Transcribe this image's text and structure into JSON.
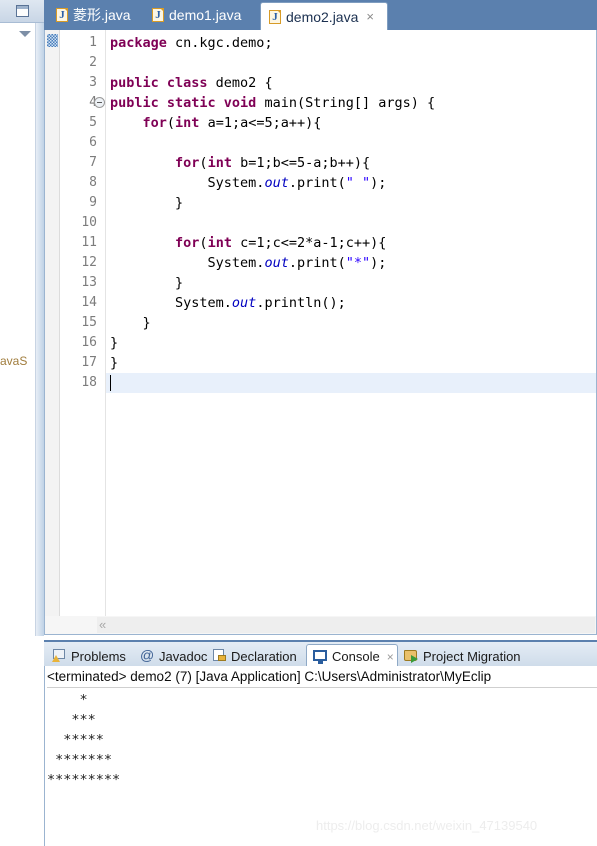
{
  "left_panel": {
    "restore_icon": "restore-icon",
    "view_menu_icon": "view-menu-arrow-icon",
    "truncated_label": "avaS"
  },
  "editor": {
    "tabs": [
      {
        "label": "菱形.java",
        "icon": "java-file-icon",
        "active": false,
        "closable": false
      },
      {
        "label": "demo1.java",
        "icon": "java-file-icon",
        "active": false,
        "closable": false
      },
      {
        "label": "demo2.java",
        "icon": "java-file-icon",
        "active": true,
        "closable": true,
        "close_label": "×"
      }
    ],
    "active_tab": "demo2.java",
    "current_line": 18,
    "scrollbar_left_arrow": "«",
    "lines": [
      {
        "n": 1,
        "fold": false,
        "marker": true,
        "tokens": [
          {
            "t": "package",
            "c": "kw"
          },
          {
            "t": " cn.kgc.demo;",
            "c": ""
          }
        ]
      },
      {
        "n": 2,
        "fold": false,
        "marker": false,
        "tokens": [
          {
            "t": "",
            "c": ""
          }
        ]
      },
      {
        "n": 3,
        "fold": false,
        "marker": false,
        "tokens": [
          {
            "t": "public class",
            "c": "kw"
          },
          {
            "t": " demo2 {",
            "c": ""
          }
        ]
      },
      {
        "n": 4,
        "fold": true,
        "marker": false,
        "tokens": [
          {
            "t": "public static void",
            "c": "kw"
          },
          {
            "t": " main(String[] args) {",
            "c": ""
          }
        ]
      },
      {
        "n": 5,
        "fold": false,
        "marker": false,
        "tokens": [
          {
            "t": "    ",
            "c": ""
          },
          {
            "t": "for",
            "c": "kw"
          },
          {
            "t": "(",
            "c": ""
          },
          {
            "t": "int",
            "c": "kw"
          },
          {
            "t": " a=1;a<=5;a++){",
            "c": ""
          }
        ]
      },
      {
        "n": 6,
        "fold": false,
        "marker": false,
        "tokens": [
          {
            "t": "",
            "c": ""
          }
        ]
      },
      {
        "n": 7,
        "fold": false,
        "marker": false,
        "tokens": [
          {
            "t": "        ",
            "c": ""
          },
          {
            "t": "for",
            "c": "kw"
          },
          {
            "t": "(",
            "c": ""
          },
          {
            "t": "int",
            "c": "kw"
          },
          {
            "t": " b=1;b<=5-a;b++){",
            "c": ""
          }
        ]
      },
      {
        "n": 8,
        "fold": false,
        "marker": false,
        "tokens": [
          {
            "t": "            System.",
            "c": ""
          },
          {
            "t": "out",
            "c": "fld"
          },
          {
            "t": ".print(",
            "c": ""
          },
          {
            "t": "\" \"",
            "c": "str"
          },
          {
            "t": ");",
            "c": ""
          }
        ]
      },
      {
        "n": 9,
        "fold": false,
        "marker": false,
        "tokens": [
          {
            "t": "        }",
            "c": ""
          }
        ]
      },
      {
        "n": 10,
        "fold": false,
        "marker": false,
        "tokens": [
          {
            "t": "",
            "c": ""
          }
        ]
      },
      {
        "n": 11,
        "fold": false,
        "marker": false,
        "tokens": [
          {
            "t": "        ",
            "c": ""
          },
          {
            "t": "for",
            "c": "kw"
          },
          {
            "t": "(",
            "c": ""
          },
          {
            "t": "int",
            "c": "kw"
          },
          {
            "t": " c=1;c<=2*a-1;c++){",
            "c": ""
          }
        ]
      },
      {
        "n": 12,
        "fold": false,
        "marker": false,
        "tokens": [
          {
            "t": "            System.",
            "c": ""
          },
          {
            "t": "out",
            "c": "fld"
          },
          {
            "t": ".print(",
            "c": ""
          },
          {
            "t": "\"*\"",
            "c": "str"
          },
          {
            "t": ");",
            "c": ""
          }
        ]
      },
      {
        "n": 13,
        "fold": false,
        "marker": false,
        "tokens": [
          {
            "t": "        }",
            "c": ""
          }
        ]
      },
      {
        "n": 14,
        "fold": false,
        "marker": false,
        "tokens": [
          {
            "t": "        System.",
            "c": ""
          },
          {
            "t": "out",
            "c": "fld"
          },
          {
            "t": ".println();",
            "c": ""
          }
        ]
      },
      {
        "n": 15,
        "fold": false,
        "marker": false,
        "tokens": [
          {
            "t": "    }",
            "c": ""
          }
        ]
      },
      {
        "n": 16,
        "fold": false,
        "marker": false,
        "tokens": [
          {
            "t": "}",
            "c": ""
          }
        ]
      },
      {
        "n": 17,
        "fold": false,
        "marker": false,
        "tokens": [
          {
            "t": "}",
            "c": ""
          }
        ]
      },
      {
        "n": 18,
        "fold": false,
        "marker": false,
        "tokens": [
          {
            "t": "",
            "c": ""
          }
        ]
      }
    ]
  },
  "bottom_panel": {
    "tabs": [
      {
        "label": "Problems",
        "icon": "problems-icon",
        "active": false,
        "closable": false
      },
      {
        "label": "Javadoc",
        "icon": "javadoc-icon",
        "active": false,
        "closable": false
      },
      {
        "label": "Declaration",
        "icon": "declaration-icon",
        "active": false,
        "closable": false
      },
      {
        "label": "Console",
        "icon": "console-icon",
        "active": true,
        "closable": true,
        "close_label": "×"
      },
      {
        "label": "Project Migration",
        "icon": "migration-icon",
        "active": false,
        "closable": false
      }
    ],
    "active_tab": "Console",
    "console": {
      "header": "<terminated> demo2 (7) [Java Application] C:\\Users\\Administrator\\MyEclip",
      "output": "    *\n   ***\n  *****\n *******\n*********"
    }
  },
  "watermark": "https://blog.csdn.net/weixin_47139540",
  "colors": {
    "tabbar_blue": "#5b80ae",
    "keyword": "#7f0055",
    "string": "#2a00ff",
    "field": "#0000c0",
    "current_line": "#e8f0fb"
  }
}
